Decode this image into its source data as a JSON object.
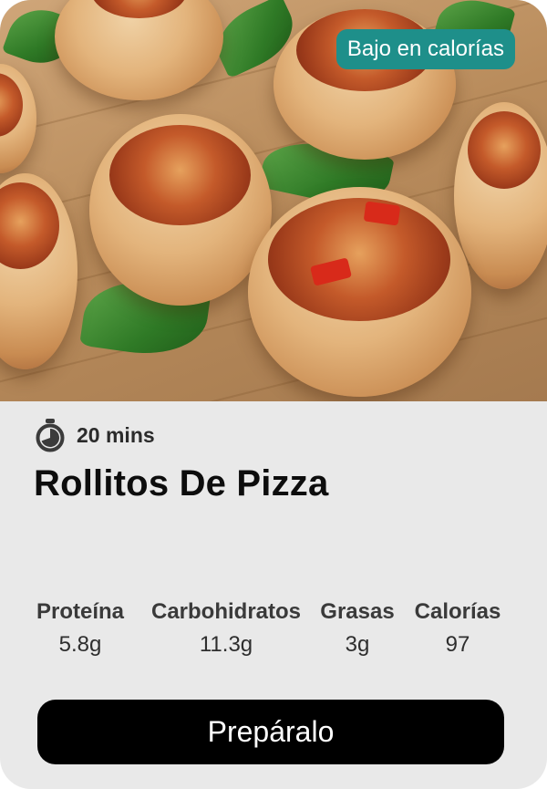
{
  "card": {
    "badge": "Bajo en calorías",
    "time": "20 mins",
    "title": "Rollitos De Pizza",
    "nutrition": [
      {
        "label": "Proteína",
        "value": "5.8g"
      },
      {
        "label": "Carbohidratos",
        "value": "11.3g"
      },
      {
        "label": "Grasas",
        "value": "3g"
      },
      {
        "label": "Calorías",
        "value": "97"
      }
    ],
    "cta_label": "Prepáralo",
    "icons": {
      "timer": "timer-icon"
    },
    "colors": {
      "badge_bg": "#1e8f8a",
      "cta_bg": "#000000",
      "card_bg": "#e9e9e9"
    }
  }
}
